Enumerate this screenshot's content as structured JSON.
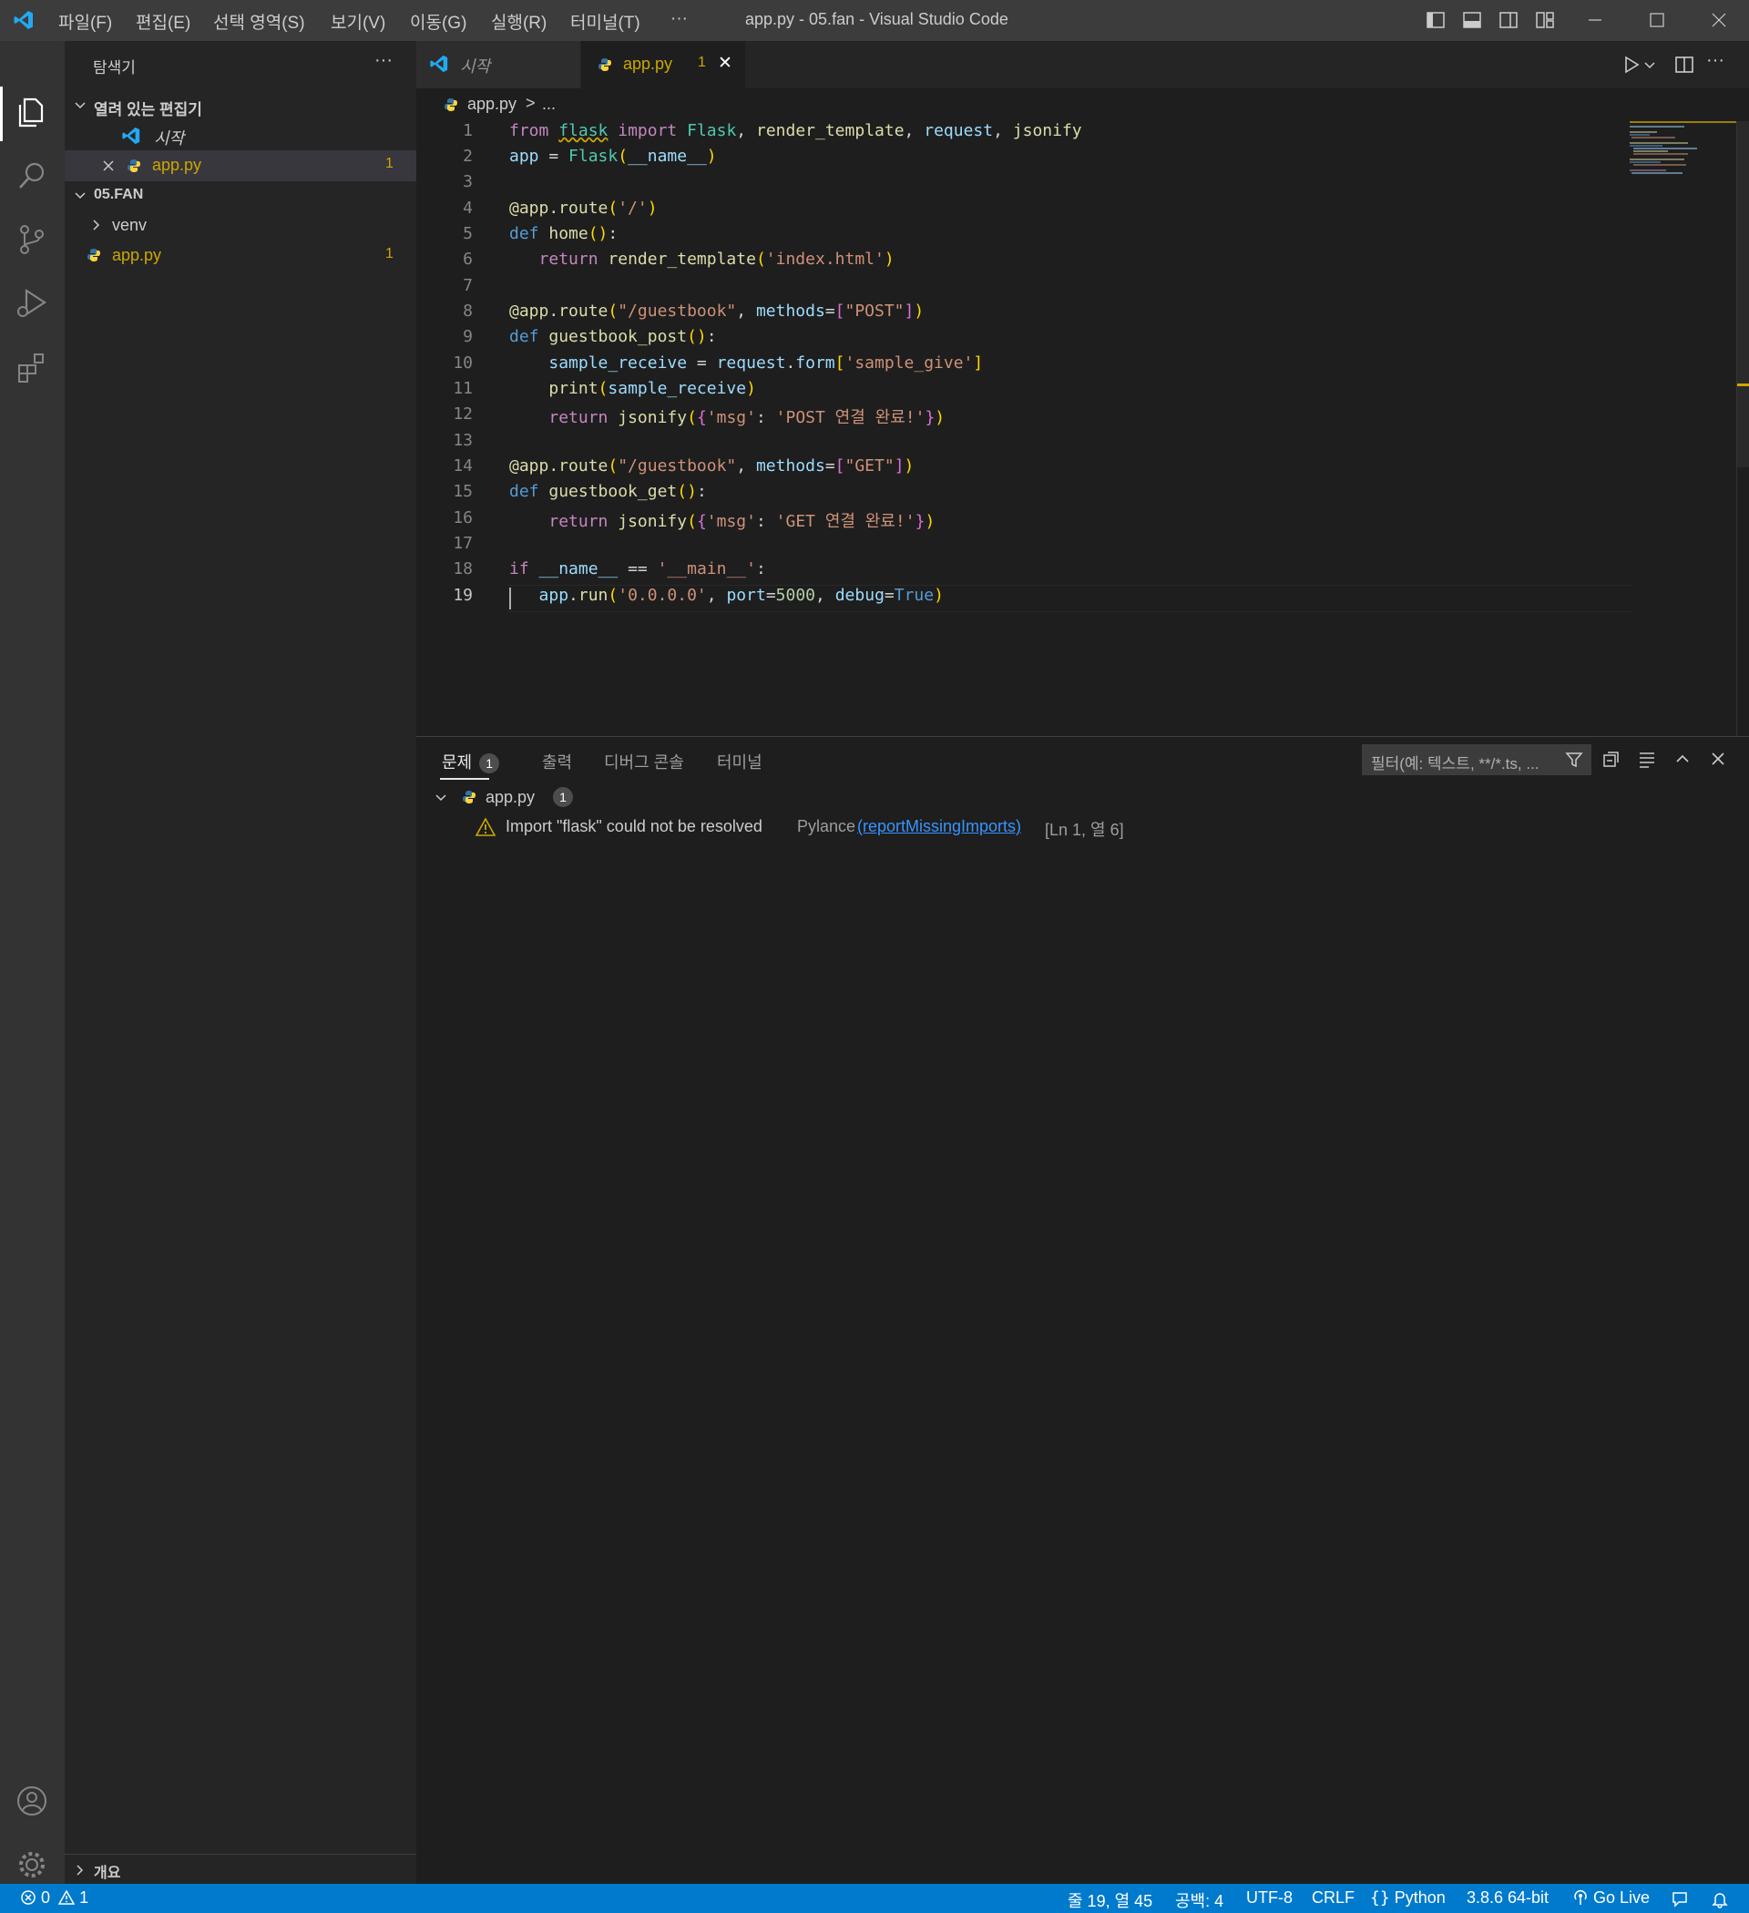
{
  "window": {
    "title": "app.py - 05.fan - Visual Studio Code",
    "menu": [
      "파일(F)",
      "편집(E)",
      "선택 영역(S)",
      "보기(V)",
      "이동(G)",
      "실행(R)",
      "터미널(T)",
      "···"
    ]
  },
  "sidebar": {
    "title": "탐색기",
    "more": "···",
    "open_editors_label": "열려 있는 편집기",
    "open_editors": [
      {
        "label": "시작",
        "italic": true
      },
      {
        "label": "app.py",
        "problems": "1"
      }
    ],
    "folder_label": "05.FAN",
    "tree": [
      {
        "label": "venv"
      },
      {
        "label": "app.py",
        "problems": "1"
      }
    ],
    "outline_label": "개요"
  },
  "tabs": [
    {
      "label": "시작"
    },
    {
      "label": "app.py",
      "problems": "1",
      "close": "✕"
    }
  ],
  "breadcrumb": {
    "file": "app.py",
    "sep": ">",
    "rest": "..."
  },
  "editor": {
    "line_numbers": [
      "1",
      "2",
      "3",
      "4",
      "5",
      "6",
      "7",
      "8",
      "9",
      "10",
      "11",
      "12",
      "13",
      "14",
      "15",
      "16",
      "17",
      "18",
      "19"
    ],
    "active_line": "19"
  },
  "panel": {
    "tabs": [
      {
        "label": "문제",
        "badge": "1"
      },
      {
        "label": "출력"
      },
      {
        "label": "디버그 콘솔"
      },
      {
        "label": "터미널"
      }
    ],
    "filter_placeholder": "필터(예: 텍스트, **/*.ts, ...",
    "problem_file": "app.py",
    "problem_count": "1",
    "problem_message": "Import \"flask\" could not be resolved",
    "problem_source": "Pylance",
    "problem_code": "(reportMissingImports)",
    "problem_location": "[Ln 1, 열 6]"
  },
  "statusbar": {
    "errors": "0",
    "warnings": "1",
    "position": "줄 19, 열 45",
    "indent": "공백: 4",
    "encoding": "UTF-8",
    "eol": "CRLF",
    "language": "Python",
    "interpreter": "3.8.6 64-bit",
    "golive": "Go Live"
  }
}
